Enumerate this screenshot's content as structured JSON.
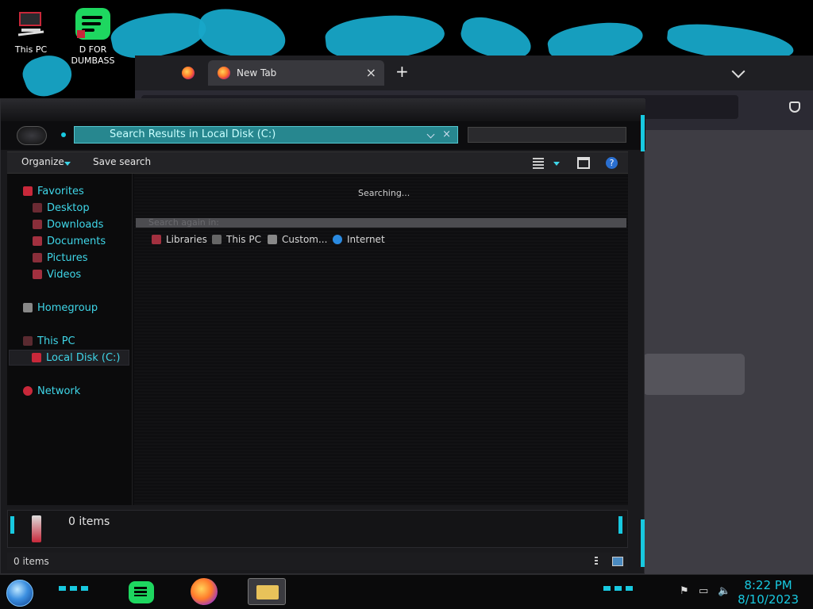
{
  "desktop": {
    "icons": [
      {
        "label": "This PC"
      },
      {
        "label": "D FOR DUMBASS"
      }
    ]
  },
  "browser": {
    "tabs": [
      {
        "label": ""
      },
      {
        "label": "New Tab"
      }
    ],
    "new_tab_glyph": "+",
    "close_glyph": "×",
    "menu_glyph": "⌄"
  },
  "explorer": {
    "address": "Search Results in Local Disk (C:)",
    "toolbar": {
      "organize": "Organize",
      "save_search": "Save search"
    },
    "nav": {
      "favorites": "Favorites",
      "desktop": "Desktop",
      "downloads": "Downloads",
      "documents": "Documents",
      "pictures": "Pictures",
      "videos": "Videos",
      "homegroup": "Homegroup",
      "this_pc": "This PC",
      "local_disk": "Local Disk (C:)",
      "network": "Network"
    },
    "content": {
      "status": "Searching...",
      "search_again": "Search again in:",
      "locations": [
        "Libraries",
        "This PC",
        "Custom...",
        "Internet"
      ]
    },
    "details_count": "0 items",
    "status_count": "0 items"
  },
  "taskbar": {
    "time": "8:22 PM",
    "date": "8/10/2023"
  },
  "colors": {
    "accent": "#18c9e0",
    "address_bg": "#27878f",
    "wallpaper_stroke": "#17a6c8"
  }
}
